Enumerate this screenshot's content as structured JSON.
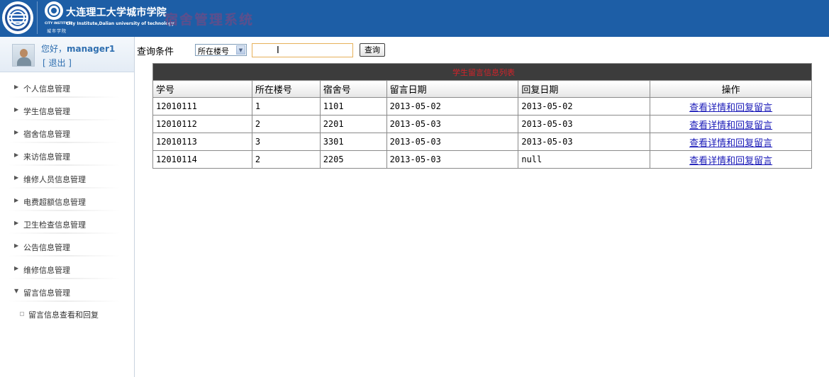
{
  "header": {
    "school_cn": "大连理工大学城市学院",
    "school_en_a": "CITY INSTITUTE",
    "school_en_b": "City Institute,Dalian university of technology",
    "school_sub": "城市学院",
    "system_title": "宿舍管理系统",
    "colors": {
      "bar": "#1d5ea6",
      "title": "#5a4d8e"
    }
  },
  "user": {
    "greeting": "您好，",
    "name": "manager1",
    "logout_label": "[ 退出 ]"
  },
  "sidebar": {
    "items": [
      {
        "label": "个人信息管理",
        "arrow": "▶"
      },
      {
        "label": "学生信息管理",
        "arrow": "▶"
      },
      {
        "label": "宿舍信息管理",
        "arrow": "▶"
      },
      {
        "label": "来访信息管理",
        "arrow": "▶"
      },
      {
        "label": "维修人员信息管理",
        "arrow": "▶"
      },
      {
        "label": "电费超额信息管理",
        "arrow": "▶"
      },
      {
        "label": "卫生检查信息管理",
        "arrow": "▶"
      },
      {
        "label": "公告信息管理",
        "arrow": "▶"
      },
      {
        "label": "维修信息管理",
        "arrow": "▶"
      },
      {
        "label": "留言信息管理",
        "arrow": "▼",
        "expanded": true
      }
    ],
    "sub_item": "留言信息查看和回复"
  },
  "search": {
    "label": "查询条件",
    "select_value": "所在楼号",
    "input_value": "",
    "button_label": "查询"
  },
  "table": {
    "caption": "学生留言信息列表",
    "columns": [
      "学号",
      "所在楼号",
      "宿舍号",
      "留言日期",
      "回复日期",
      "操作"
    ],
    "rows": [
      {
        "student_id": "12010111",
        "building": "1",
        "room": "1101",
        "msg_date": "2013-05-02",
        "reply_date": "2013-05-02",
        "action": "查看详情和回复留言"
      },
      {
        "student_id": "12010112",
        "building": "2",
        "room": "2201",
        "msg_date": "2013-05-03",
        "reply_date": "2013-05-03",
        "action": "查看详情和回复留言"
      },
      {
        "student_id": "12010113",
        "building": "3",
        "room": "3301",
        "msg_date": "2013-05-03",
        "reply_date": "2013-05-03",
        "action": "查看详情和回复留言"
      },
      {
        "student_id": "12010114",
        "building": "2",
        "room": "2205",
        "msg_date": "2013-05-03",
        "reply_date": "null",
        "action": "查看详情和回复留言"
      }
    ]
  }
}
